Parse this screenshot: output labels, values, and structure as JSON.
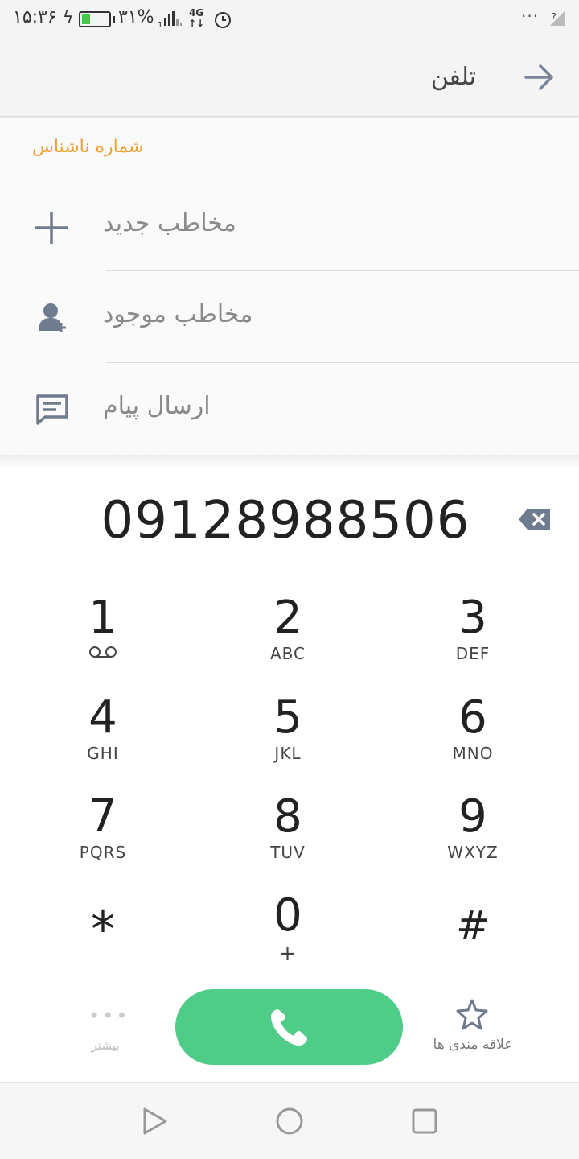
{
  "status_bar": {
    "time": "۱۵:۳۶",
    "battery_percent": "۳۱%",
    "battery_level": 0.31,
    "network_type": "4G",
    "sim_slot": "1",
    "more": "···",
    "icons": [
      "charging-bolt-icon",
      "battery-icon",
      "signal-icon",
      "network-icon",
      "alarm-icon",
      "wifi-icon"
    ]
  },
  "app_bar": {
    "title": "تلفن",
    "back_icon": "arrow-right-icon"
  },
  "unknown_number_label": "شماره ناشناس",
  "actions": [
    {
      "label": "مخاطب جدید",
      "icon": "plus-icon"
    },
    {
      "label": "مخاطب موجود",
      "icon": "person-add-icon"
    },
    {
      "label": "ارسال پیام",
      "icon": "message-icon"
    }
  ],
  "dialer": {
    "number": "09128988506",
    "backspace_icon": "backspace-icon",
    "keys": [
      {
        "digit": "1",
        "letters": "",
        "icon": "voicemail-icon"
      },
      {
        "digit": "2",
        "letters": "ABC"
      },
      {
        "digit": "3",
        "letters": "DEF"
      },
      {
        "digit": "4",
        "letters": "GHI"
      },
      {
        "digit": "5",
        "letters": "JKL"
      },
      {
        "digit": "6",
        "letters": "MNO"
      },
      {
        "digit": "7",
        "letters": "PQRS"
      },
      {
        "digit": "8",
        "letters": "TUV"
      },
      {
        "digit": "9",
        "letters": "WXYZ"
      },
      {
        "digit": "*",
        "letters": ""
      },
      {
        "digit": "0",
        "letters": "+"
      },
      {
        "digit": "#",
        "letters": ""
      }
    ]
  },
  "bottom": {
    "more_label": "بیشتر",
    "favorites_label": "علاقه مندی ها",
    "call_icon": "phone-icon",
    "accent_color": "#4ecc88"
  },
  "nav_bar": {
    "icons": [
      "back-triangle-icon",
      "home-circle-icon",
      "recents-square-icon"
    ]
  }
}
